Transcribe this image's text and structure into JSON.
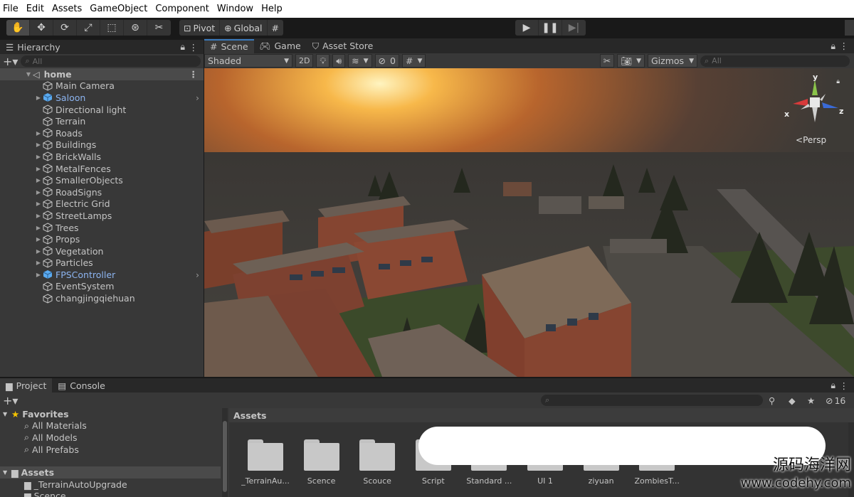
{
  "menu": [
    "File",
    "Edit",
    "Assets",
    "GameObject",
    "Component",
    "Window",
    "Help"
  ],
  "toolbar": {
    "pivot": "Pivot",
    "global": "Global"
  },
  "hierarchy": {
    "title": "Hierarchy",
    "search_placeholder": "All",
    "scene_name": "home",
    "items": [
      {
        "label": "Main Camera",
        "arrow": false,
        "blue": false,
        "chevron": false
      },
      {
        "label": "Saloon",
        "arrow": true,
        "blue": true,
        "chevron": true
      },
      {
        "label": "Directional light",
        "arrow": false,
        "blue": false,
        "chevron": false
      },
      {
        "label": "Terrain",
        "arrow": false,
        "blue": false,
        "chevron": false
      },
      {
        "label": "Roads",
        "arrow": true,
        "blue": false,
        "chevron": false
      },
      {
        "label": "Buildings",
        "arrow": true,
        "blue": false,
        "chevron": false
      },
      {
        "label": "BrickWalls",
        "arrow": true,
        "blue": false,
        "chevron": false
      },
      {
        "label": "MetalFences",
        "arrow": true,
        "blue": false,
        "chevron": false
      },
      {
        "label": "SmallerObjects",
        "arrow": true,
        "blue": false,
        "chevron": false
      },
      {
        "label": "RoadSigns",
        "arrow": true,
        "blue": false,
        "chevron": false
      },
      {
        "label": "Electric Grid",
        "arrow": true,
        "blue": false,
        "chevron": false
      },
      {
        "label": "StreetLamps",
        "arrow": true,
        "blue": false,
        "chevron": false
      },
      {
        "label": "Trees",
        "arrow": true,
        "blue": false,
        "chevron": false
      },
      {
        "label": "Props",
        "arrow": true,
        "blue": false,
        "chevron": false
      },
      {
        "label": "Vegetation",
        "arrow": true,
        "blue": false,
        "chevron": false
      },
      {
        "label": "Particles",
        "arrow": true,
        "blue": false,
        "chevron": false
      },
      {
        "label": "FPSController",
        "arrow": true,
        "blue": true,
        "chevron": true
      },
      {
        "label": "EventSystem",
        "arrow": false,
        "blue": false,
        "chevron": false
      },
      {
        "label": "changjingqiehuan",
        "arrow": false,
        "blue": false,
        "chevron": false
      }
    ]
  },
  "scene": {
    "tabs": [
      "Scene",
      "Game",
      "Asset Store"
    ],
    "draw_mode": "Shaded",
    "mode_2d": "2D",
    "hidden_count": "0",
    "gizmos": "Gizmos",
    "search_placeholder": "All",
    "persp": "Persp",
    "axis_x": "x",
    "axis_y": "y",
    "axis_z": "z"
  },
  "project": {
    "tabs": [
      "Project",
      "Console"
    ],
    "favorites_title": "Favorites",
    "favorites": [
      "All Materials",
      "All Models",
      "All Prefabs"
    ],
    "assets_title": "Assets",
    "assets_children": [
      "_TerrainAutoUpgrade",
      "Scence"
    ],
    "breadcrumb": "Assets",
    "hidden_count": "16",
    "assets": [
      "_TerrainAu...",
      "Scence",
      "Scouce",
      "Script",
      "Standard ...",
      "UI 1",
      "ziyuan",
      "ZombiesT..."
    ]
  },
  "watermark": {
    "line1": "源码海洋网",
    "line2": "www.codehy.com"
  },
  "colors": {
    "panel": "#383838",
    "accent_blue": "#3a79bb",
    "prefab_blue": "#8cb4f0"
  }
}
